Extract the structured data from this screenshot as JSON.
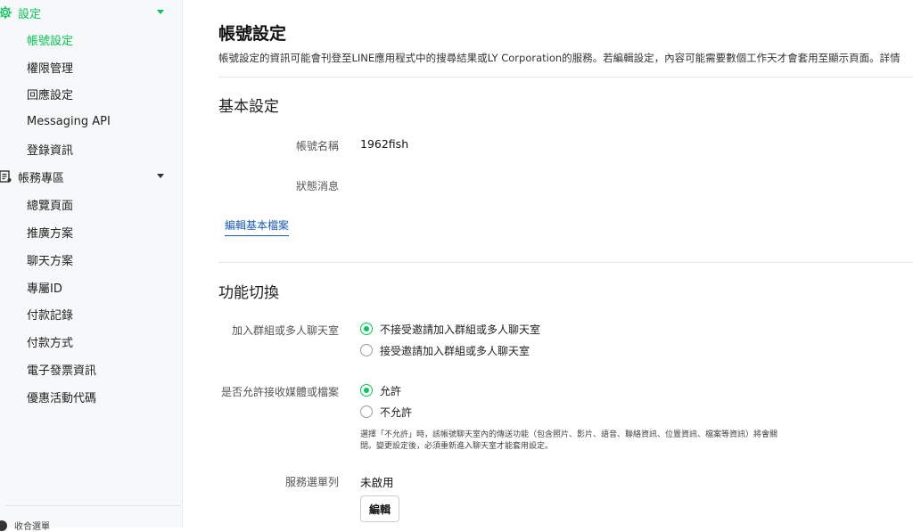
{
  "sidebar": {
    "settings_section": {
      "label": "設定",
      "icon": "gear-icon"
    },
    "settings_items": [
      {
        "label": "帳號設定"
      },
      {
        "label": "權限管理"
      },
      {
        "label": "回應設定"
      },
      {
        "label": "Messaging API"
      },
      {
        "label": "登錄資訊"
      }
    ],
    "account_section": {
      "label": "帳務專區",
      "icon": "receipt-icon"
    },
    "account_items": [
      {
        "label": "總覽頁面"
      },
      {
        "label": "推廣方案"
      },
      {
        "label": "聊天方案"
      },
      {
        "label": "專屬ID"
      },
      {
        "label": "付款記錄"
      },
      {
        "label": "付款方式"
      },
      {
        "label": "電子發票資訊"
      },
      {
        "label": "優惠活動代碼"
      }
    ],
    "footer": {
      "label": "收合選單"
    }
  },
  "main": {
    "title": "帳號設定",
    "description": "帳號設定的資訊可能會刊登至LINE應用程式中的搜尋結果或LY Corporation的服務。若編輯設定，內容可能需要數個工作天才會套用至顯示頁面。詳情",
    "basic": {
      "title": "基本設定",
      "account_name_label": "帳號名稱",
      "account_name_value": "1962fish",
      "status_label": "狀態消息",
      "edit_link": "編輯基本檔案"
    },
    "features": {
      "title": "功能切換",
      "group_label": "加入群組或多人聊天室",
      "group_options": [
        "不接受邀請加入群組或多人聊天室",
        "接受邀請加入群組或多人聊天室"
      ],
      "media_label": "是否允許接收媒體或檔案",
      "media_options": [
        "允許",
        "不允許"
      ],
      "media_note": "選擇「不允許」時，該帳號聊天室內的傳送功能（包含照片、影片、語音、聯絡資訊、位置資訊、檔案等資訊）將會關閉。變更設定後，必須重新進入聊天室才能套用設定。",
      "menu_label": "服務選單列",
      "menu_value": "未啟用",
      "edit_button": "編輯"
    }
  },
  "colors": {
    "accent": "#06c755",
    "link": "#1a5bb8"
  }
}
